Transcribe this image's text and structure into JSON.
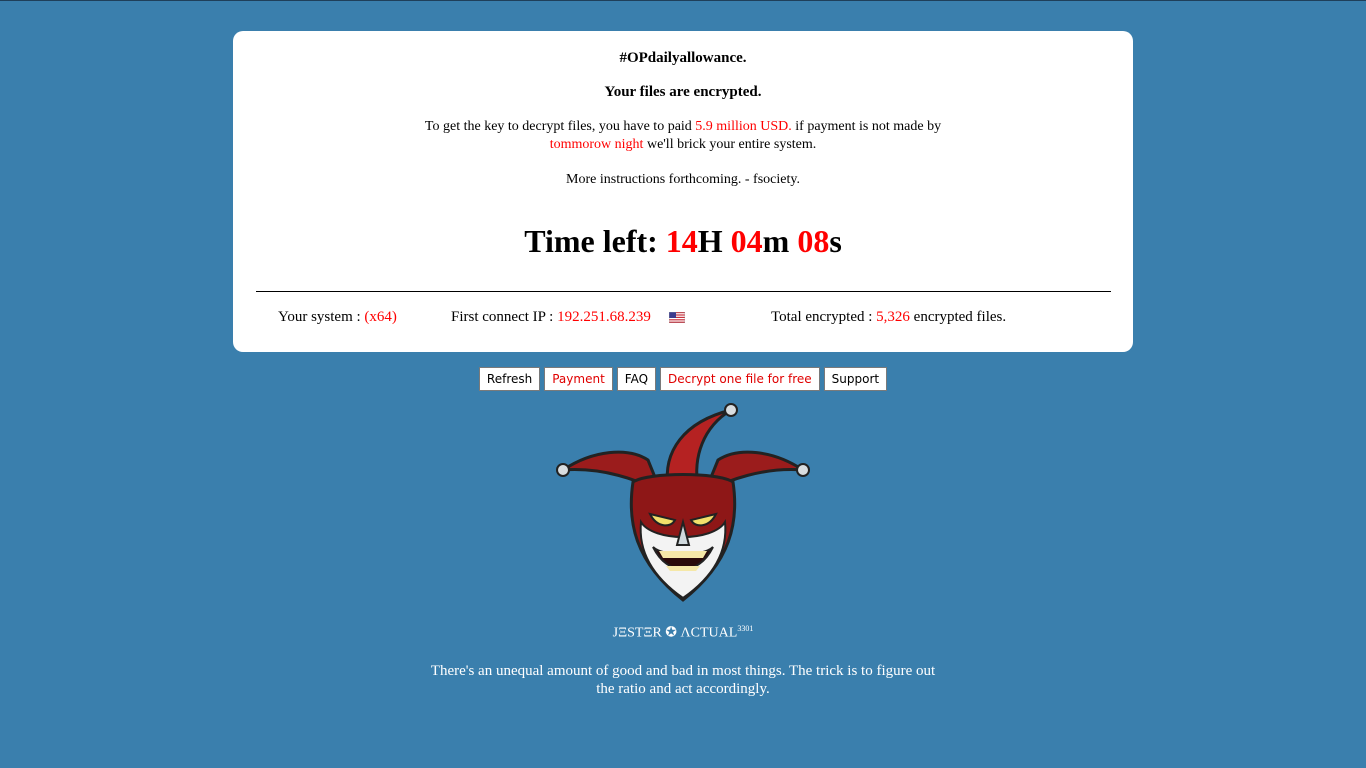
{
  "note": {
    "hashtag": "#OPdailyallowance.",
    "headline": "Your files are encrypted.",
    "message_part1": "To get the key to decrypt files, you have to paid ",
    "amount": "5.9 million USD.",
    "message_part2": " if payment is not made by ",
    "deadline": "tommorow night",
    "message_part3": " we'll brick your entire system.",
    "more": "More instructions forthcoming. - fsociety."
  },
  "timer": {
    "label": "Time left: ",
    "hours": "14",
    "hours_unit": "H ",
    "minutes": "04",
    "minutes_unit": "m ",
    "seconds": "08",
    "seconds_unit": "s"
  },
  "info": {
    "system_label": "Your system : ",
    "system_value": "(x64)",
    "ip_label": "First connect IP : ",
    "ip_value": "192.251.68.239",
    "flag_icon": "us-flag-icon",
    "total_label": "Total encrypted : ",
    "total_value": "5,326",
    "total_suffix": " encrypted files."
  },
  "buttons": {
    "refresh": "Refresh",
    "payment": "Payment",
    "faq": "FAQ",
    "decrypt_free": "Decrypt one file for free",
    "support": "Support"
  },
  "signature": {
    "name": "JΞSTΞR ✪ ΛCTUAL",
    "superscript": "3301"
  },
  "quote": "There's an unequal amount of good and bad in most things. The trick is to figure out the ratio and act accordingly.",
  "colors": {
    "background": "#3a7fad",
    "accent_red": "#ff0000",
    "card": "#ffffff"
  }
}
